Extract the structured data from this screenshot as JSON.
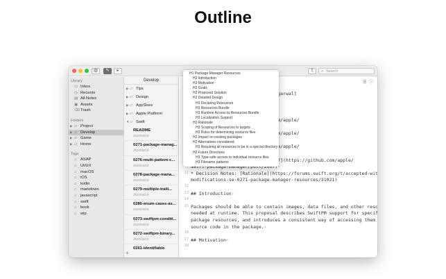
{
  "page": {
    "title": "Outline"
  },
  "window": {
    "traffic_lights": {
      "close": "#fe5f57",
      "minimize": "#febc2e",
      "zoom": "#28c840"
    },
    "toolbar": {
      "sidebar_toggle_icon": "sidebar-icon",
      "compose_icon": "compose-icon",
      "preview_icon": "preview-icon",
      "share_icon": "share-icon"
    },
    "search": {
      "placeholder": "Search"
    }
  },
  "sidebar": {
    "library_heading": "Library",
    "library_items": [
      {
        "label": "Inbox",
        "icon": "inbox-icon"
      },
      {
        "label": "Recents",
        "icon": "clock-icon"
      },
      {
        "label": "All Notes",
        "icon": "notes-icon"
      },
      {
        "label": "Assets",
        "icon": "image-icon"
      },
      {
        "label": "Trash",
        "icon": "trash-icon"
      }
    ],
    "folders_heading": "Folders",
    "folders": [
      {
        "label": "Project",
        "selected": false
      },
      {
        "label": "Develop",
        "selected": true
      },
      {
        "label": "Game",
        "selected": false
      },
      {
        "label": "Home",
        "selected": false
      }
    ],
    "tags_heading": "Tags",
    "tags": [
      "ASAP",
      "UI/UX",
      "macOS",
      "iOS",
      "kotlin",
      "markdown",
      "javascript",
      "swift",
      "book",
      "wip"
    ]
  },
  "notelist": {
    "header": "Develop",
    "subfolders": [
      {
        "label": "Tips",
        "expanded": false
      },
      {
        "label": "Design",
        "expanded": false
      },
      {
        "label": "AppStore",
        "expanded": false
      },
      {
        "label": "Apple Platform",
        "expanded": false
      },
      {
        "label": "Swift",
        "expanded": true
      }
    ],
    "notes": [
      {
        "title": "README",
        "date": "2020/04/19"
      },
      {
        "title": "0271-package-manag...",
        "date": "2020/04/19"
      },
      {
        "title": "0276-multi-pattern-c...",
        "date": "2020/04/19"
      },
      {
        "title": "0278-package-mana...",
        "date": "2020/04/19"
      },
      {
        "title": "0279-multiple-traili...",
        "date": "2020/04/19"
      },
      {
        "title": "0280-enum-cases-as...",
        "date": "2020/04/19"
      },
      {
        "title": "0273-swiftpm-conditi...",
        "date": "2020/04/19"
      },
      {
        "title": "0272-swiftpm-binary...",
        "date": "2020/04/19"
      },
      {
        "title": "0261-identifiable",
        "date": ""
      }
    ],
    "add_label": "+"
  },
  "outline": {
    "items": [
      {
        "level": 1,
        "text": "H1 Package Manager Resources"
      },
      {
        "level": 2,
        "text": "H2 Introduction"
      },
      {
        "level": 2,
        "text": "H2 Motivation"
      },
      {
        "level": 2,
        "text": "H2 Goals"
      },
      {
        "level": 2,
        "text": "H2 Proposed Solution"
      },
      {
        "level": 2,
        "text": "H2 Detailed Design"
      },
      {
        "level": 3,
        "text": "H3 Declaring Resources"
      },
      {
        "level": 3,
        "text": "H3 Resources Bundle"
      },
      {
        "level": 3,
        "text": "H3 Runtime Access to Resources Bundle"
      },
      {
        "level": 3,
        "text": "H3 Localization Support"
      },
      {
        "level": 2,
        "text": "H2 Rationale"
      },
      {
        "level": 3,
        "text": "H3 Scoping of Resources to targets"
      },
      {
        "level": 3,
        "text": "H3 Rules for determining resource files"
      },
      {
        "level": 2,
        "text": "H2 Impact on existing packages"
      },
      {
        "level": 2,
        "text": "H2 Alternatives considered"
      },
      {
        "level": 3,
        "text": "H3 Requiring all resources to be in a special directory"
      },
      {
        "level": 2,
        "text": "H2 Future Directions"
      },
      {
        "level": 3,
        "text": "H3 Type-safe access to individual resource files"
      },
      {
        "level": 3,
        "text": "H3 Filename patterns"
      }
    ]
  },
  "editor": {
    "lines": [
      {
        "num": "",
        "text": "                    anager-resources.md)"
      },
      {
        "num": "",
        "text": "                    ithub.com/abertelrud), [Ankit Aggarwal]"
      },
      {
        "num": "",
        "text": ""
      },
      {
        "num": "",
        "text": "                    ps://github.com/neonichu)"
      },
      {
        "num": "",
        "text": ""
      },
      {
        "num": "",
        "text": "                    -manager#2381](https://github.com/apple/"
      },
      {
        "num": "",
        "text": ""
      },
      {
        "num": "",
        "text": "                    -manager#2510](https://github.com/apple/"
      },
      {
        "num": "",
        "text": ""
      },
      {
        "num": "",
        "text": "                    -manager#2520](https://github.com/apple/"
      },
      {
        "num": "",
        "text": ""
      },
      {
        "num": "",
        "text": "          [apple/swift-package-manager#2607](https://github.com/apple/"
      },
      {
        "num": "",
        "text": "swift-package-manager/pull/2607)·"
      },
      {
        "num": "11",
        "text": "* Decision Notes: [Rationale](https://forums.swift.org/t/accepted-with-"
      },
      {
        "num": "",
        "text": "modifications-se-0271-package-manager-resources/31021)"
      },
      {
        "num": "12",
        "text": ""
      },
      {
        "num": "13",
        "text": "## Introduction·"
      },
      {
        "num": "14",
        "text": ""
      },
      {
        "num": "15",
        "text": "Packages should be able to contain images, data files, and other resources"
      },
      {
        "num": "",
        "text": "needed at runtime.  This proposal describes SwiftPM support for specifying such"
      },
      {
        "num": "",
        "text": "package resources, and introduces a consistent way of accessing them from the"
      },
      {
        "num": "",
        "text": "source code in the package.·"
      },
      {
        "num": "16",
        "text": ""
      },
      {
        "num": "17",
        "text": "## Motivation·"
      },
      {
        "num": "18",
        "text": ""
      }
    ]
  }
}
